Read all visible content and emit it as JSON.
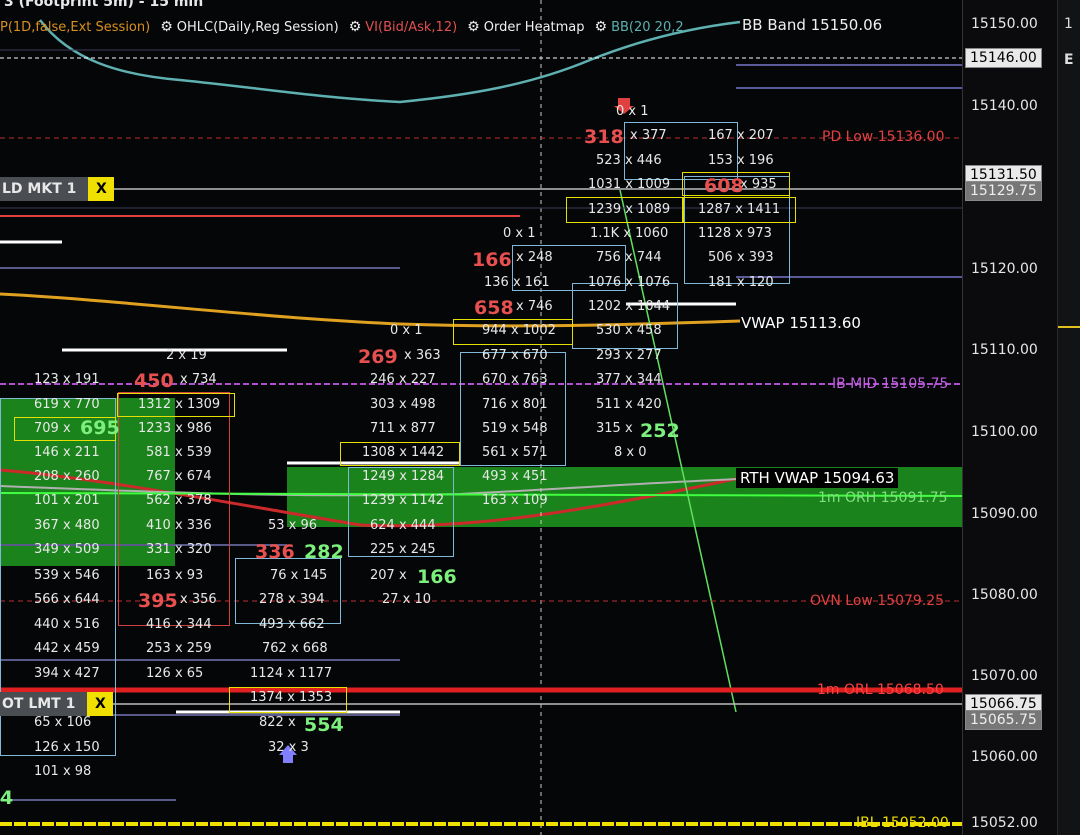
{
  "title": "3 (Footprint 5m) - 15 min",
  "indicators": [
    {
      "label": "P(1D,false,Ext Session)",
      "color": "#d99020",
      "gear": false
    },
    {
      "label": "OHLC(Daily,Reg Session)",
      "color": "#f0f0f0",
      "gear": true
    },
    {
      "label": "VI(Bid/Ask,12)",
      "color": "#e05050",
      "gear": true
    },
    {
      "label": "Order Heatmap",
      "color": "#f0f0f0",
      "gear": true
    },
    {
      "label": "BB(20 20,2",
      "color": "#5fb0b0",
      "gear": true
    }
  ],
  "bb_overlay": "BB Band 15150.06",
  "price_axis": {
    "ticks": [
      "15150.00",
      "15140.00",
      "15120.00",
      "15110.00",
      "15100.00",
      "15090.00",
      "15080.00",
      "15070.00",
      "15060.00",
      "15052.00"
    ],
    "highlight_top": "15146.00",
    "highlight_mid": "15131.50",
    "highlight_mid2": "15129.75",
    "highlight_low": "15066.75",
    "highlight_low2": "15065.75"
  },
  "orders": {
    "market_label": "LD MKT 1",
    "limit_label": "OT LMT 1",
    "cancel": "X"
  },
  "levels": {
    "pd_low": "PD Low 15136.00",
    "vwap": "VWAP 15113.60",
    "ib_mid": "IB MID 15105.75",
    "rth_vwap": "RTH VWAP 15094.63",
    "orh": "1m ORH 15091.75",
    "ovn_low": "OVN Low 15079.25",
    "orl": "1m ORL 15068.50",
    "ibl": "IBL 15052.00"
  },
  "edge_labels": [
    "1",
    "E"
  ],
  "footprint": {
    "col1": [
      {
        "t": "123 x 191"
      },
      {
        "t": "619 x 770"
      },
      {
        "t": "709 x"
      },
      {
        "t": "146 x 211"
      },
      {
        "t": "208 x 260"
      },
      {
        "t": "101 x 201"
      },
      {
        "t": "367 x 480"
      },
      {
        "t": "349 x 509"
      },
      {
        "t": "539 x 546"
      },
      {
        "t": "566 x 644"
      },
      {
        "t": "440 x 516"
      },
      {
        "t": "442 x 459"
      },
      {
        "t": "394 x 427"
      },
      {
        "t": "65 x 106"
      },
      {
        "t": "126 x 150"
      },
      {
        "t": "101 x 98"
      }
    ],
    "col1_big": "695",
    "col2": [
      {
        "t": "2 x 19"
      },
      {
        "t": "x 734"
      },
      {
        "t": "1312 x 1309"
      },
      {
        "t": "1233 x 986"
      },
      {
        "t": "581 x 539"
      },
      {
        "t": "767 x 674"
      },
      {
        "t": "562 x 378"
      },
      {
        "t": "410 x 336"
      },
      {
        "t": "331 x 320"
      },
      {
        "t": "163 x 93"
      },
      {
        "t": "x 356"
      },
      {
        "t": "416 x 344"
      },
      {
        "t": "253 x 259"
      },
      {
        "t": "126 x 65"
      }
    ],
    "col2_big_a": "450",
    "col2_big_b": "395",
    "col3": [
      {
        "t": "53 x 96"
      },
      {
        "t": "76 x 145"
      },
      {
        "t": "278 x 394"
      },
      {
        "t": "493 x 662"
      },
      {
        "t": "762 x 668"
      },
      {
        "t": "1124 x 1177"
      },
      {
        "t": "1374 x 1353"
      },
      {
        "t": "822 x"
      },
      {
        "t": "32 x 3"
      }
    ],
    "col3_big_a": "336",
    "col3_big_b": "282",
    "col3_big_c": "554",
    "col4": [
      {
        "t": "0 x 1"
      },
      {
        "t": "x 363"
      },
      {
        "t": "246 x 227"
      },
      {
        "t": "303 x 498"
      },
      {
        "t": "711 x 877"
      },
      {
        "t": "1308 x 1442"
      },
      {
        "t": "1249 x 1284"
      },
      {
        "t": "1239 x 1142"
      },
      {
        "t": "624 x 444"
      },
      {
        "t": "225 x 245"
      },
      {
        "t": "207 x"
      },
      {
        "t": "27 x 10"
      }
    ],
    "col4_big_a": "269",
    "col4_big_b": "166",
    "col5": [
      {
        "t": "x 248"
      },
      {
        "t": "136 x 161"
      },
      {
        "t": "x 746"
      },
      {
        "t": "944 x 1002"
      },
      {
        "t": "677 x 670"
      },
      {
        "t": "670 x 763"
      },
      {
        "t": "716 x 801"
      },
      {
        "t": "519 x 548"
      },
      {
        "t": "561 x 571"
      },
      {
        "t": "493 x 451"
      },
      {
        "t": "163 x 109"
      }
    ],
    "col5_big_a": "166",
    "col5_big_b": "658",
    "col6": [
      {
        "t": "x 377"
      },
      {
        "t": "523 x 446"
      },
      {
        "t": "1031 x 1009"
      },
      {
        "t": "1239 x 1089"
      },
      {
        "t": "0 x 1"
      },
      {
        "t": "1.1K x 1060"
      },
      {
        "t": "756 x 744"
      },
      {
        "t": "1076 x 1076"
      },
      {
        "t": "1202 x 1044"
      },
      {
        "t": "530 x 458"
      },
      {
        "t": "293 x 277"
      },
      {
        "t": "377 x 344"
      },
      {
        "t": "511 x 420"
      },
      {
        "t": "315 x"
      },
      {
        "t": "8 x 0"
      },
      {
        "t": "0 x 1"
      }
    ],
    "col6_big_a": "318",
    "col6_big_b": "252",
    "col7": [
      {
        "t": "167 x 207"
      },
      {
        "t": "153 x 196"
      },
      {
        "t": "x 935"
      },
      {
        "t": "1287 x 1411"
      },
      {
        "t": "1128 x 973"
      },
      {
        "t": "506 x 393"
      },
      {
        "t": "181 x 120"
      }
    ],
    "col7_big": "608",
    "extra_bottom": "4"
  },
  "colors": {
    "green_zone": "#1f9a1f",
    "red_level": "#e02020",
    "ib_mid": "#b050d0",
    "ibl": "#f0e000",
    "vwap": "#e0a020",
    "bb": "#5fb0b0"
  }
}
